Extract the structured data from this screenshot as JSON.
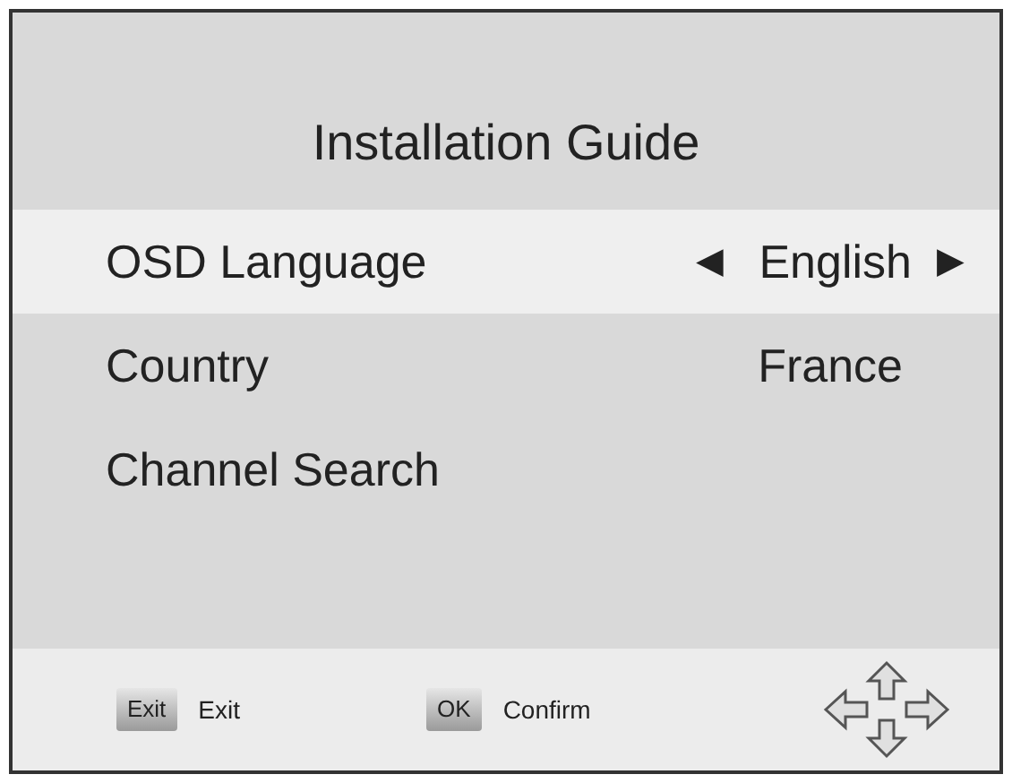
{
  "title": "Installation Guide",
  "items": [
    {
      "label": "OSD Language",
      "value": "English",
      "left_arrow": "◀",
      "right_arrow": "▶",
      "selected": true
    },
    {
      "label": "Country",
      "value": "France",
      "selected": false
    },
    {
      "label": "Channel Search",
      "selected": false
    }
  ],
  "footer": [
    {
      "key": "Exit",
      "label": "Exit"
    },
    {
      "key": "OK",
      "label": "Confirm"
    }
  ]
}
